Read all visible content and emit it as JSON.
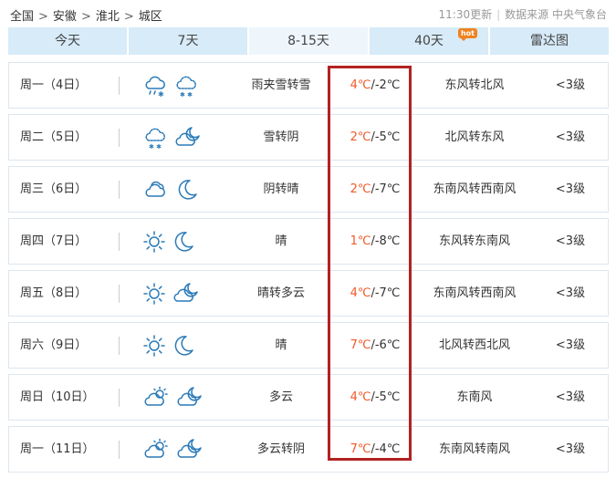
{
  "breadcrumb": [
    "全国",
    "安徽",
    "淮北",
    "城区"
  ],
  "update_time": "11:30更新",
  "source": "数据来源 中央气象台",
  "tabs": [
    {
      "label": "今天",
      "active": false
    },
    {
      "label": "7天",
      "active": false
    },
    {
      "label": "8-15天",
      "active": true
    },
    {
      "label": "40天",
      "active": false,
      "badge": "hot"
    },
    {
      "label": "雷达图",
      "active": false
    }
  ],
  "forecast": [
    {
      "day": "周一（4日）",
      "icons": [
        "rain-snow-icon",
        "snow-cloud-icon"
      ],
      "weather": "雨夹雪转雪",
      "high": "4℃",
      "low": "/-2℃",
      "wind": "东风转北风",
      "level": "<3级"
    },
    {
      "day": "周二（5日）",
      "icons": [
        "snow-cloud-icon",
        "cloudy-night-icon"
      ],
      "weather": "雪转阴",
      "high": "2℃",
      "low": "/-5℃",
      "wind": "北风转东风",
      "level": "<3级"
    },
    {
      "day": "周三（6日）",
      "icons": [
        "overcast-icon",
        "moon-icon"
      ],
      "weather": "阴转晴",
      "high": "2℃",
      "low": "/-7℃",
      "wind": "东南风转西南风",
      "level": "<3级"
    },
    {
      "day": "周四（7日）",
      "icons": [
        "sun-icon",
        "moon-icon"
      ],
      "weather": "晴",
      "high": "1℃",
      "low": "/-8℃",
      "wind": "东风转东南风",
      "level": "<3级"
    },
    {
      "day": "周五（8日）",
      "icons": [
        "sun-icon",
        "cloudy-night-icon"
      ],
      "weather": "晴转多云",
      "high": "4℃",
      "low": "/-7℃",
      "wind": "东南风转西南风",
      "level": "<3级"
    },
    {
      "day": "周六（9日）",
      "icons": [
        "sun-icon",
        "moon-icon"
      ],
      "weather": "晴",
      "high": "7℃",
      "low": "/-6℃",
      "wind": "北风转西北风",
      "level": "<3级"
    },
    {
      "day": "周日（10日）",
      "icons": [
        "partly-cloudy-icon",
        "cloudy-night-icon"
      ],
      "weather": "多云",
      "high": "4℃",
      "low": "/-5℃",
      "wind": "东南风",
      "level": "<3级"
    },
    {
      "day": "周一（11日）",
      "icons": [
        "partly-cloudy-icon",
        "cloudy-night-icon"
      ],
      "weather": "多云转阴",
      "high": "7℃",
      "low": "/-4℃",
      "wind": "东南风转南风",
      "level": "<3级"
    }
  ],
  "colors": {
    "tab_bg": "#d7ebf8",
    "tab_active_bg": "#eef6fc",
    "high_temp": "#f05a28",
    "highlight_box": "#b22222",
    "icon_stroke": "#2a7ab8"
  }
}
